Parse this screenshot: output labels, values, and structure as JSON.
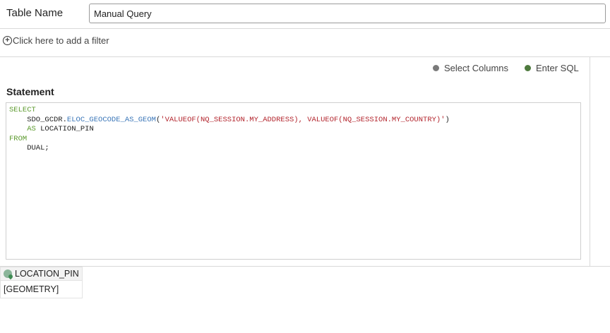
{
  "table_name": {
    "label": "Table Name",
    "value": "Manual Query"
  },
  "filter": {
    "label": "Click here to add a filter",
    "icon": "plus-circle-icon"
  },
  "mode": {
    "options": [
      {
        "label": "Select Columns",
        "color": "#7a7a7a"
      },
      {
        "label": "Enter SQL",
        "color": "#4e7a3e",
        "selected": true
      }
    ]
  },
  "statement": {
    "label": "Statement",
    "lines": [
      [
        {
          "t": "SELECT",
          "c": "kw"
        }
      ],
      [
        {
          "t": "    SDO_GCDR.",
          "c": "tx"
        },
        {
          "t": "ELOC_GEOCODE_AS_GEOM",
          "c": "fn"
        },
        {
          "t": "(",
          "c": "tx"
        },
        {
          "t": "'VALUEOF(NQ_SESSION.MY_ADDRESS), VALUEOF(NQ_SESSION.MY_COUNTRY)'",
          "c": "str"
        },
        {
          "t": ")",
          "c": "tx"
        }
      ],
      [
        {
          "t": "    ",
          "c": "tx"
        },
        {
          "t": "AS",
          "c": "kw"
        },
        {
          "t": " LOCATION_PIN",
          "c": "tx"
        }
      ],
      [
        {
          "t": "FROM",
          "c": "kw"
        }
      ],
      [
        {
          "t": "    DUAL;",
          "c": "tx"
        }
      ]
    ]
  },
  "result": {
    "column": "LOCATION_PIN",
    "column_icon": "geometry-icon",
    "value": "[GEOMETRY]"
  }
}
